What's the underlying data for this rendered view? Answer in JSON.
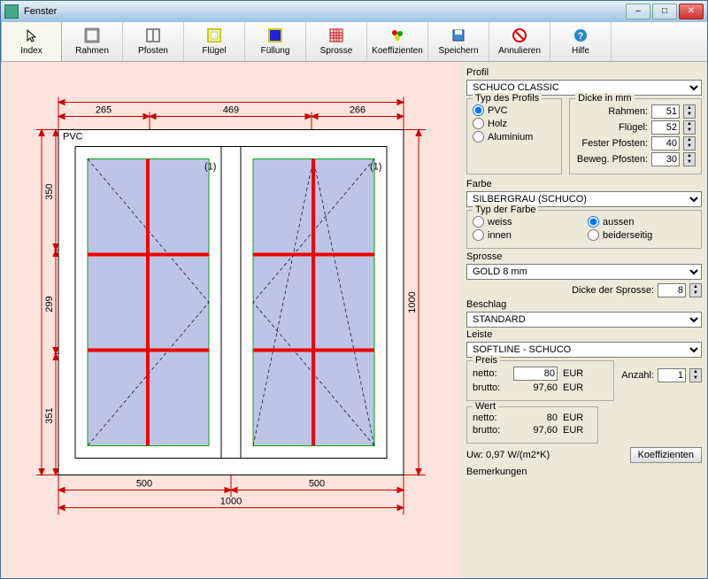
{
  "title": "Fenster",
  "toolbar": [
    {
      "label": "Index",
      "icon": "cursor"
    },
    {
      "label": "Rahmen",
      "icon": "frame"
    },
    {
      "label": "Pfosten",
      "icon": "mullion"
    },
    {
      "label": "Flügel",
      "icon": "sash"
    },
    {
      "label": "Füllung",
      "icon": "fill"
    },
    {
      "label": "Sprosse",
      "icon": "muntin"
    },
    {
      "label": "Koeffizienten",
      "icon": "coef"
    },
    {
      "label": "Speichern",
      "icon": "save"
    },
    {
      "label": "Annulieren",
      "icon": "cancel"
    },
    {
      "label": "Hilfe",
      "icon": "help"
    }
  ],
  "drawing": {
    "material_label": "PVC",
    "sash_index_1": "(1)",
    "sash_index_2": "(1)",
    "dims_top": [
      "265",
      "469",
      "266"
    ],
    "dims_bottom": [
      "500",
      "500"
    ],
    "dim_bottom_total": "1000",
    "dim_right": "1000",
    "dims_left": [
      "350",
      "299",
      "351"
    ]
  },
  "props": {
    "profil_label": "Profil",
    "profil_value": "SCHUCO CLASSIC",
    "typ_profil_legend": "Typ des Profils",
    "typ_profil_options": [
      "PVC",
      "Holz",
      "Aluminium"
    ],
    "typ_profil_selected": "PVC",
    "dicke_legend": "Dicke in mm",
    "dicke_rahmen_label": "Rahmen:",
    "dicke_rahmen": "51",
    "dicke_fluegel_label": "Flügel:",
    "dicke_fluegel": "52",
    "dicke_fester_label": "Fester Pfosten:",
    "dicke_fester": "40",
    "dicke_beweg_label": "Beweg. Pfosten:",
    "dicke_beweg": "30",
    "farbe_label": "Farbe",
    "farbe_value": "SILBERGRAU (SCHUCO)",
    "typ_farbe_legend": "Typ der Farbe",
    "typ_farbe_options": [
      "weiss",
      "aussen",
      "innen",
      "beiderseitig"
    ],
    "typ_farbe_selected": "aussen",
    "sprosse_label": "Sprosse",
    "sprosse_value": "GOLD 8 mm",
    "sprosse_dicke_label": "Dicke der Sprosse:",
    "sprosse_dicke": "8",
    "beschlag_label": "Beschlag",
    "beschlag_value": "STANDARD",
    "leiste_label": "Leiste",
    "leiste_value": "SOFTLINE - SCHUCO",
    "preis_legend": "Preis",
    "netto_label": "netto:",
    "netto_value": "80",
    "netto_cur": "EUR",
    "brutto_label": "brutto:",
    "brutto_value": "97,60",
    "brutto_cur": "EUR",
    "anzahl_label": "Anzahl:",
    "anzahl_value": "1",
    "wert_legend": "Wert",
    "wert_netto": "80",
    "wert_netto_cur": "EUR",
    "wert_brutto": "97,60",
    "wert_brutto_cur": "EUR",
    "uw_label": "Uw:",
    "uw_value": "0,97 W/(m2*K)",
    "koef_btn": "Koeffizienten",
    "bemerkungen_label": "Bemerkungen"
  }
}
